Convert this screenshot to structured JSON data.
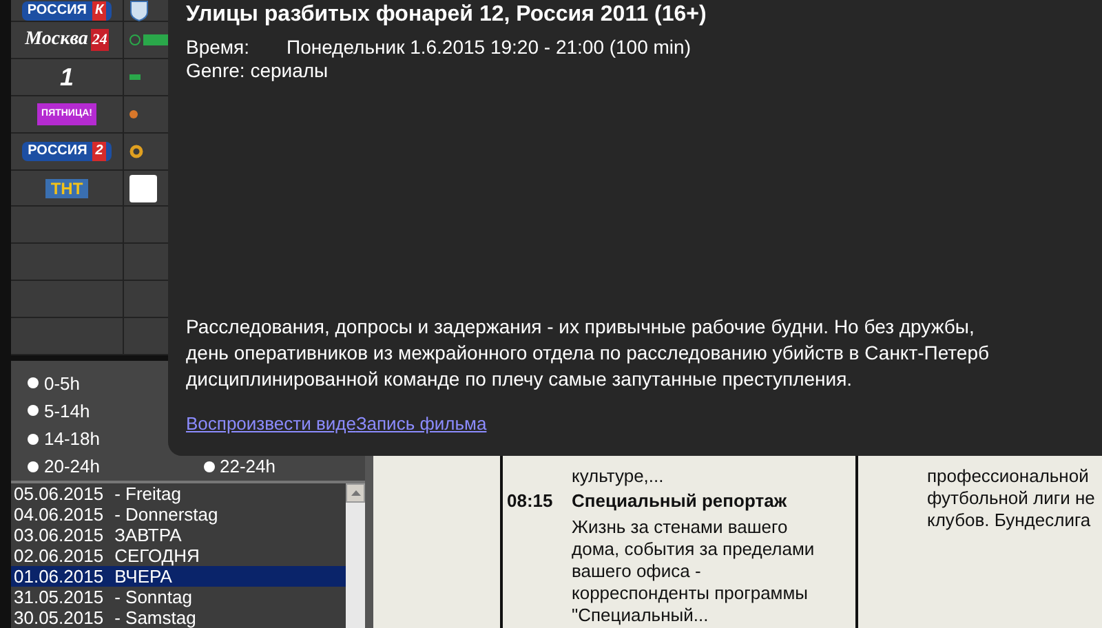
{
  "channels": [
    {
      "kind": "rossiya",
      "text": "РОССИЯ",
      "badge": "К"
    },
    {
      "kind": "moskva",
      "text": "Москва",
      "badge": "24"
    },
    {
      "kind": "perviy",
      "text": "1"
    },
    {
      "kind": "pyatnica",
      "text": "ПЯТНИЦА!"
    },
    {
      "kind": "rossiya",
      "text": "РОССИЯ",
      "badge": "2"
    },
    {
      "kind": "tnt",
      "text": "ТНТ"
    }
  ],
  "time_filters": [
    {
      "label": "0-5h",
      "selected": false
    },
    {
      "label": "5-14h",
      "selected": false
    },
    {
      "label": "14-18h",
      "selected": false
    },
    {
      "label": "20-24h",
      "selected": false
    },
    {
      "label": "22-24h",
      "selected": false
    }
  ],
  "dates": [
    {
      "date": "05.06.2015",
      "day": "- Freitag",
      "selected": false
    },
    {
      "date": "04.06.2015",
      "day": "- Donnerstag",
      "selected": false
    },
    {
      "date": "03.06.2015",
      "day": "ЗАВТРА",
      "selected": false
    },
    {
      "date": "02.06.2015",
      "day": "СЕГОДНЯ",
      "selected": false
    },
    {
      "date": "01.06.2015",
      "day": "ВЧЕРА",
      "selected": true
    },
    {
      "date": "31.05.2015",
      "day": "- Sonntag",
      "selected": false
    },
    {
      "date": "30.05.2015",
      "day": "- Samstag",
      "selected": false
    }
  ],
  "schedule": {
    "column_2": {
      "tail": "культуре,...",
      "programs": [
        {
          "time": "08:15",
          "title": "Специальный репортаж",
          "description": "Жизнь за стенами вашего дома, события за пределами вашего офиса - корреспонденты программы \"Специальный..."
        }
      ]
    },
    "column_3": {
      "lines": [
        "профессиональной",
        "футбольной лиги не",
        "клубов. Бундеслига"
      ]
    }
  },
  "popup": {
    "title": "Улицы разбитых фонарей 12, Россия 2011 (16+)",
    "time_label": "Время:",
    "time_value": "Понедельник 1.6.2015 19:20 - 21:00 (100 min)",
    "genre": "Genre: сериалы",
    "description_lines": [
      "Расследования, допросы и задержания - их привычные рабочие будни. Но без дружбы,",
      "день оперативников из межрайонного отдела по расследованию убийств в Санкт-Петерб",
      "дисциплинированной команде по плечу самые запутанные преступления."
    ],
    "links": [
      "Воспроизвести виде",
      "Запись фильма"
    ]
  }
}
